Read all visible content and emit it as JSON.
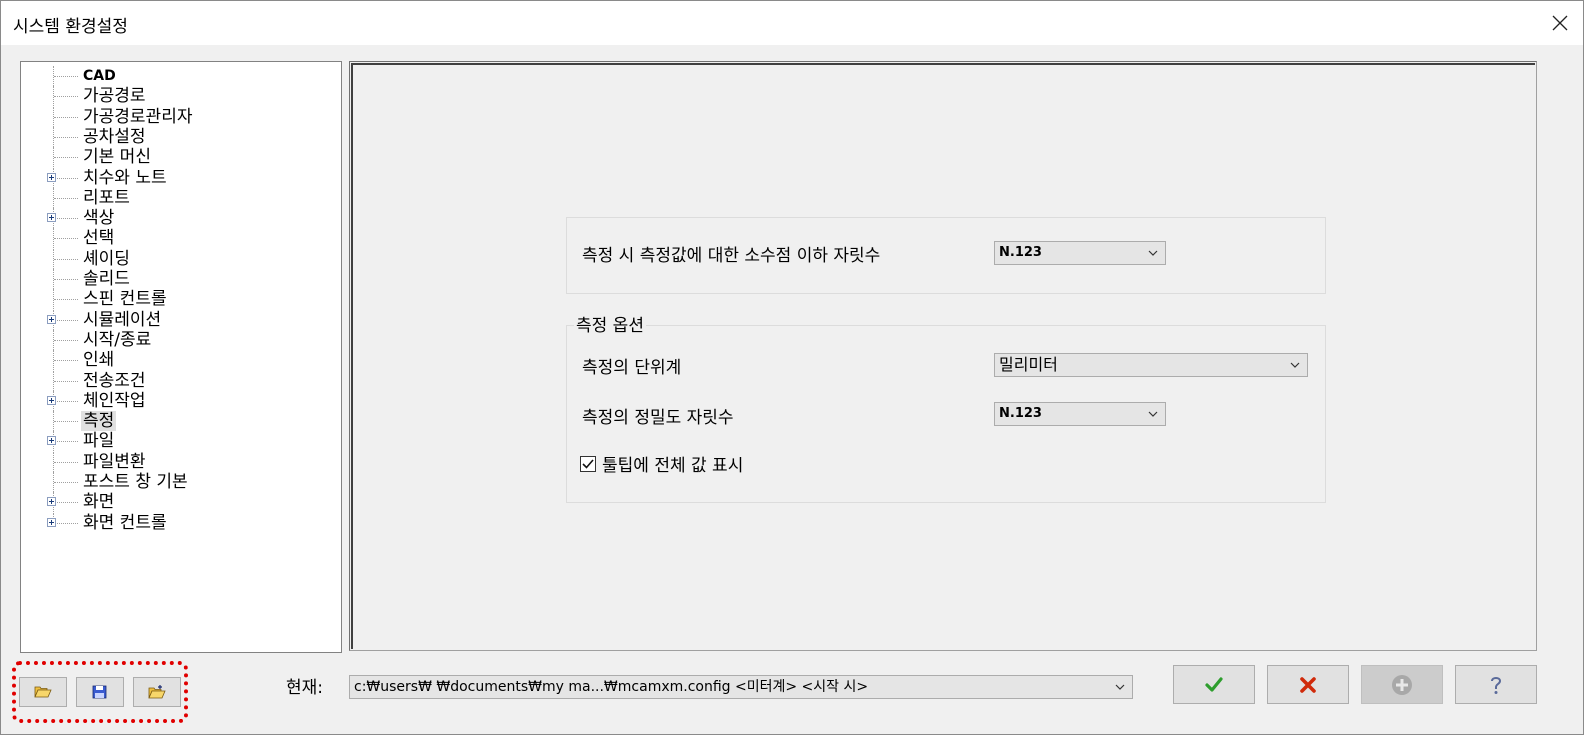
{
  "window": {
    "title": "시스템 환경설정"
  },
  "tree": {
    "items": [
      {
        "label": "CAD",
        "expandable": false
      },
      {
        "label": "가공경로",
        "expandable": false
      },
      {
        "label": "가공경로관리자",
        "expandable": false
      },
      {
        "label": "공차설정",
        "expandable": false
      },
      {
        "label": "기본 머신",
        "expandable": false
      },
      {
        "label": "치수와 노트",
        "expandable": true
      },
      {
        "label": "리포트",
        "expandable": false
      },
      {
        "label": "색상",
        "expandable": true
      },
      {
        "label": "선택",
        "expandable": false
      },
      {
        "label": "셰이딩",
        "expandable": false
      },
      {
        "label": "솔리드",
        "expandable": false
      },
      {
        "label": "스핀 컨트롤",
        "expandable": false
      },
      {
        "label": "시뮬레이션",
        "expandable": true
      },
      {
        "label": "시작/종료",
        "expandable": false
      },
      {
        "label": "인쇄",
        "expandable": false
      },
      {
        "label": "전송조건",
        "expandable": false
      },
      {
        "label": "체인작업",
        "expandable": true
      },
      {
        "label": "측정",
        "expandable": false,
        "selected": true
      },
      {
        "label": "파일",
        "expandable": true
      },
      {
        "label": "파일변환",
        "expandable": false
      },
      {
        "label": "포스트 창 기본",
        "expandable": false
      },
      {
        "label": "화면",
        "expandable": true
      },
      {
        "label": "화면 컨트롤",
        "expandable": true
      }
    ]
  },
  "measure": {
    "decimal_label": "측정 시 측정값에 대한 소수점 이하 자릿수",
    "decimal_value": "N.123",
    "options_title": "측정 옵션",
    "unit_label": "측정의 단위계",
    "unit_value": "밀리미터",
    "precision_label": "측정의 정밀도 자릿수",
    "precision_value": "N.123",
    "tooltip_label": "툴팁에 전체 값 표시",
    "tooltip_checked": true
  },
  "footer": {
    "current_label": "현재:",
    "current_path": "c:₩users₩                    ₩documents₩my ma...₩mcamxm.config <미터계> <시작 시>"
  },
  "icons": {
    "open": "folder-open-icon",
    "save": "save-icon",
    "merge": "folder-merge-icon",
    "ok": "checkmark-icon",
    "cancel": "x-icon",
    "add": "plus-icon",
    "help": "help-icon"
  },
  "colors": {
    "ok": "#2e9e2e",
    "cancel": "#d02a0a",
    "highlight": "#e00000"
  }
}
